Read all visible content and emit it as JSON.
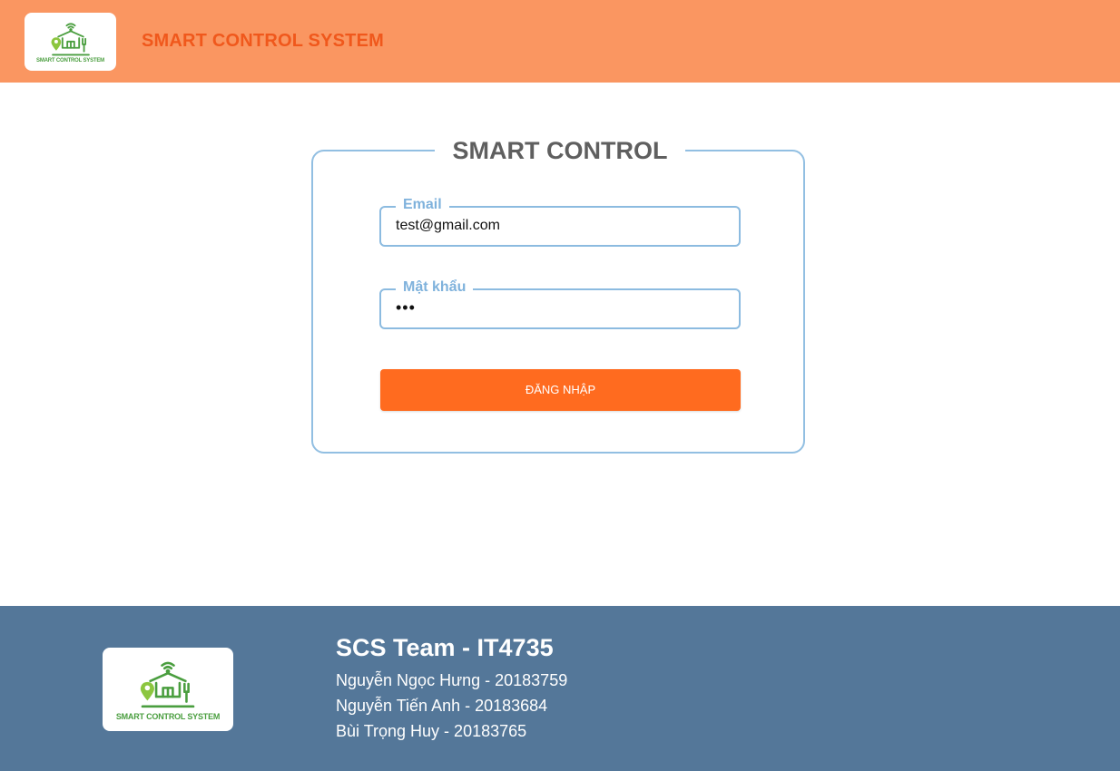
{
  "header": {
    "logo_text": "SMART CONTROL SYSTEM",
    "title": "SMART CONTROL SYSTEM"
  },
  "login": {
    "title": "SMART CONTROL",
    "email_label": "Email",
    "email_value": "test@gmail.com",
    "password_label": "Mật khẩu",
    "password_value": "•••",
    "submit_label": "ĐĂNG NHẬP"
  },
  "footer": {
    "logo_text": "SMART CONTROL SYSTEM",
    "team": "SCS Team - IT4735",
    "members": [
      "Nguyễn Ngọc Hưng - 20183759",
      "Nguyễn Tiến Anh - 20183684",
      "Bùi Trọng Huy - 20183765"
    ]
  },
  "colors": {
    "header_bg": "#fa9661",
    "header_title": "#f0581c",
    "accent_button": "#ff6b1f",
    "field_border": "#8cbbe0",
    "footer_bg": "#547799",
    "logo_green": "#4a9e3f"
  },
  "icons": {
    "logo": "smart-home-logo-icon"
  }
}
